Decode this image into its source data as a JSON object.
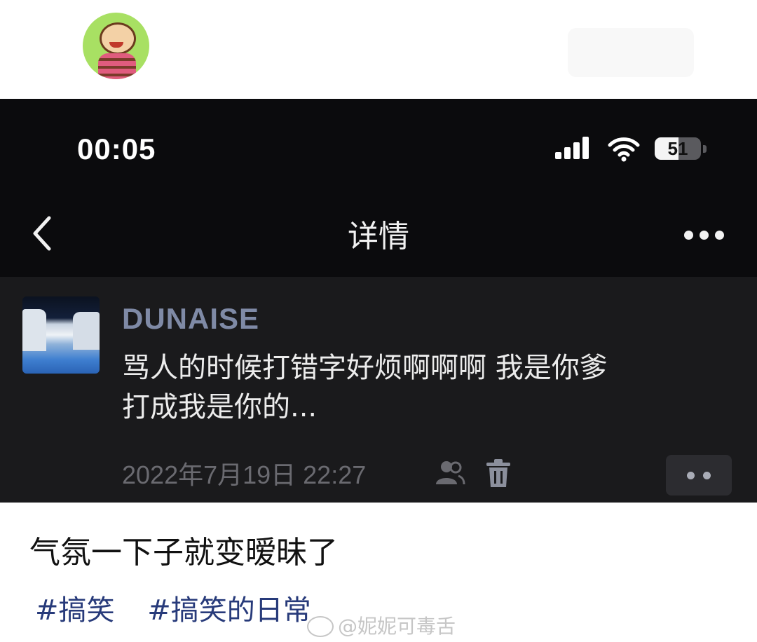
{
  "status_bar": {
    "time": "00:05",
    "battery_level": "51"
  },
  "nav": {
    "title": "详情"
  },
  "post": {
    "username": "DUNAISE",
    "content_line1": "骂人的时候打错字好烦啊啊啊 我是你爹",
    "content_line2": "打成我是你的...",
    "timestamp": "2022年7月19日 22:27"
  },
  "caption": {
    "text": "气氛一下子就变暧昧了"
  },
  "tags": [
    "#搞笑",
    "#搞笑的日常"
  ],
  "watermark": {
    "text": "@妮妮可毒舌"
  },
  "colors": {
    "screen_bg": "#0b0b0d",
    "card_bg": "#1a1a1c",
    "username": "#7f8aa6",
    "tag": "#273a7a"
  }
}
